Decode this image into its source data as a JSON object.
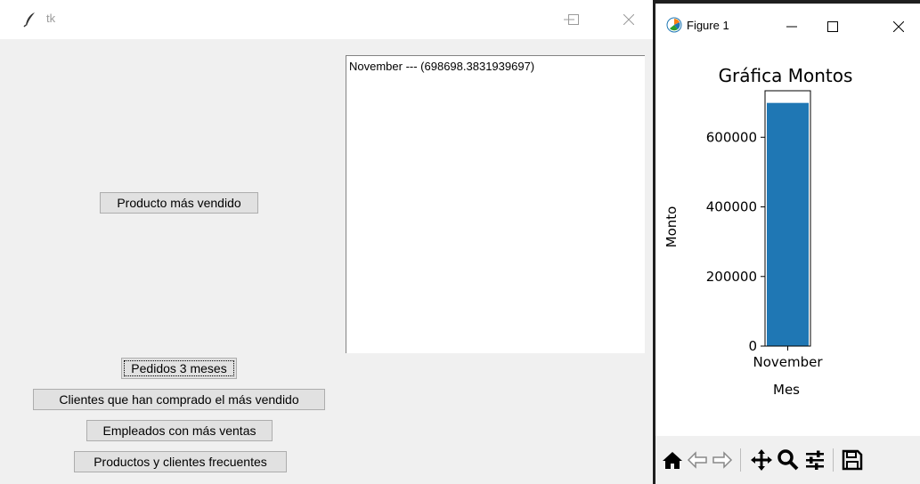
{
  "tk_window": {
    "title": "tk",
    "buttons": {
      "producto_mas_vendido": "Producto más vendido",
      "pedidos_3_meses": "Pedidos 3 meses",
      "clientes_mas_vendido": "Clientes que han comprado el más vendido",
      "empleados_mas_ventas": "Empleados con más ventas",
      "productos_clientes_frecuentes": "Productos y clientes frecuentes"
    },
    "listbox_items": [
      "November --- (698698.3831939697)"
    ]
  },
  "figure_window": {
    "title": "Figure 1"
  },
  "chart_data": {
    "type": "bar",
    "title": "Gráfica Montos",
    "xlabel": "Mes",
    "ylabel": "Monto",
    "categories": [
      "November"
    ],
    "values": [
      698698.3831939697
    ],
    "ylim": [
      0,
      733633
    ],
    "yticks": [
      0,
      200000,
      400000,
      600000
    ],
    "ytick_labels": [
      "0",
      "200000",
      "400000",
      "600000"
    ],
    "bar_color": "#1f77b4",
    "grid": false
  },
  "toolbar": {
    "tools": [
      "home-icon",
      "back-icon",
      "forward-icon",
      "pan-icon",
      "zoom-icon",
      "configure-subplots-icon",
      "save-icon"
    ]
  }
}
